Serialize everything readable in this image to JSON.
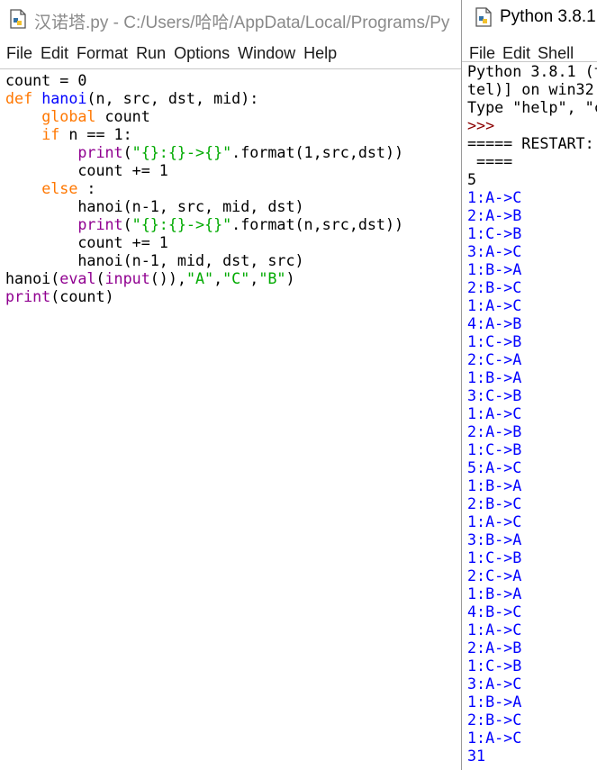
{
  "editor": {
    "title": "汉诺塔.py - C:/Users/哈哈/AppData/Local/Programs/Py",
    "menu": [
      "File",
      "Edit",
      "Format",
      "Run",
      "Options",
      "Window",
      "Help"
    ],
    "code_lines": [
      [
        {
          "t": "count = 0",
          "c": ""
        }
      ],
      [
        {
          "t": "def ",
          "c": "kw"
        },
        {
          "t": "hanoi",
          "c": "fn"
        },
        {
          "t": "(n, src, dst, mid):",
          "c": ""
        }
      ],
      [
        {
          "t": "    ",
          "c": ""
        },
        {
          "t": "global",
          "c": "kw"
        },
        {
          "t": " count",
          "c": ""
        }
      ],
      [
        {
          "t": "    ",
          "c": ""
        },
        {
          "t": "if",
          "c": "kw"
        },
        {
          "t": " n == 1:",
          "c": ""
        }
      ],
      [
        {
          "t": "        ",
          "c": ""
        },
        {
          "t": "print",
          "c": "bi"
        },
        {
          "t": "(",
          "c": ""
        },
        {
          "t": "\"{}:{}->{}\"",
          "c": "st"
        },
        {
          "t": ".format(1,src,dst))",
          "c": ""
        }
      ],
      [
        {
          "t": "        count += 1",
          "c": ""
        }
      ],
      [
        {
          "t": "    ",
          "c": ""
        },
        {
          "t": "else",
          "c": "kw"
        },
        {
          "t": " :",
          "c": ""
        }
      ],
      [
        {
          "t": "        hanoi(n-1, src, mid, dst)",
          "c": ""
        }
      ],
      [
        {
          "t": "        ",
          "c": ""
        },
        {
          "t": "print",
          "c": "bi"
        },
        {
          "t": "(",
          "c": ""
        },
        {
          "t": "\"{}:{}->{}\"",
          "c": "st"
        },
        {
          "t": ".format(n,src,dst))",
          "c": ""
        }
      ],
      [
        {
          "t": "        count += 1",
          "c": ""
        }
      ],
      [
        {
          "t": "        hanoi(n-1, mid, dst, src)",
          "c": ""
        }
      ],
      [
        {
          "t": "hanoi(",
          "c": ""
        },
        {
          "t": "eval",
          "c": "bi"
        },
        {
          "t": "(",
          "c": ""
        },
        {
          "t": "input",
          "c": "bi"
        },
        {
          "t": "()),",
          "c": ""
        },
        {
          "t": "\"A\"",
          "c": "st"
        },
        {
          "t": ",",
          "c": ""
        },
        {
          "t": "\"C\"",
          "c": "st"
        },
        {
          "t": ",",
          "c": ""
        },
        {
          "t": "\"B\"",
          "c": "st"
        },
        {
          "t": ")",
          "c": ""
        }
      ],
      [
        {
          "t": "print",
          "c": "bi"
        },
        {
          "t": "(count)",
          "c": ""
        }
      ]
    ]
  },
  "shell": {
    "title": "Python 3.8.1",
    "menu": [
      "File",
      "Edit",
      "Shell"
    ],
    "header_lines": [
      "Python 3.8.1 (t",
      "tel)] on win32",
      "Type \"help\", \"c"
    ],
    "prompt": ">>>",
    "restart_lines": [
      "===== RESTART:",
      " ===="
    ],
    "input_value": "5",
    "output_lines": [
      "1:A->C",
      "2:A->B",
      "1:C->B",
      "3:A->C",
      "1:B->A",
      "2:B->C",
      "1:A->C",
      "4:A->B",
      "1:C->B",
      "2:C->A",
      "1:B->A",
      "3:C->B",
      "1:A->C",
      "2:A->B",
      "1:C->B",
      "5:A->C",
      "1:B->A",
      "2:B->C",
      "1:A->C",
      "3:B->A",
      "1:C->B",
      "2:C->A",
      "1:B->A",
      "4:B->C",
      "1:A->C",
      "2:A->B",
      "1:C->B",
      "3:A->C",
      "1:B->A",
      "2:B->C",
      "1:A->C"
    ],
    "result": "31"
  }
}
